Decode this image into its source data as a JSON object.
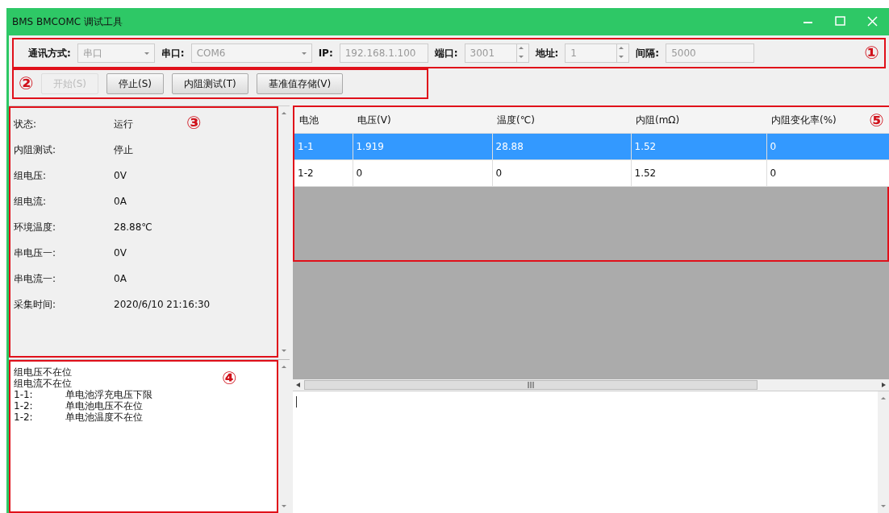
{
  "window": {
    "title": "BMS BMCOMC 调试工具"
  },
  "settings": [
    {
      "kind": "combo",
      "label": "通讯方式:",
      "value": "串口",
      "disabled": true
    },
    {
      "kind": "combo",
      "label": "串口:",
      "value": "COM6",
      "disabled": true
    },
    {
      "kind": "text",
      "label": "IP:",
      "value": "192.168.1.100",
      "disabled": true
    },
    {
      "kind": "spin",
      "label": "端口:",
      "value": "3001",
      "disabled": true
    },
    {
      "kind": "spin",
      "label": "地址:",
      "value": "1",
      "disabled": true
    },
    {
      "kind": "text",
      "label": "间隔:",
      "value": "5000",
      "disabled": true
    }
  ],
  "buttons": [
    {
      "label": "开始(S)",
      "disabled": true
    },
    {
      "label": "停止(S)",
      "disabled": false
    },
    {
      "label": "内阻测试(T)",
      "disabled": false
    },
    {
      "label": "基准值存储(V)",
      "disabled": false
    }
  ],
  "status": [
    {
      "label": "状态:",
      "value": "运行"
    },
    {
      "label": "内阻测试:",
      "value": "停止"
    },
    {
      "label": "组电压:",
      "value": "0V"
    },
    {
      "label": "组电流:",
      "value": "0A"
    },
    {
      "label": "环境温度:",
      "value": "28.88℃"
    },
    {
      "label": "串电压一:",
      "value": "0V"
    },
    {
      "label": "串电流一:",
      "value": "0A"
    },
    {
      "label": "采集时间:",
      "value": "2020/6/10 21:16:30"
    }
  ],
  "log": [
    {
      "text": "组电压不在位"
    },
    {
      "text": "组电流不在位"
    },
    {
      "prefix": "1-1:",
      "text": "单电池浮充电压下限"
    },
    {
      "prefix": "1-2:",
      "text": "单电池电压不在位"
    },
    {
      "prefix": "1-2:",
      "text": "单电池温度不在位"
    }
  ],
  "table": {
    "columns": [
      "电池",
      "电压(V)",
      "温度(℃)",
      "内阻(mΩ)",
      "内阻变化率(%)"
    ],
    "rows": [
      {
        "cells": [
          "1-1",
          "1.919",
          "28.88",
          "1.52",
          "0"
        ],
        "selected": true
      },
      {
        "cells": [
          "1-2",
          "0",
          "0",
          "1.52",
          "0"
        ],
        "selected": false
      }
    ]
  },
  "markers": [
    "①",
    "②",
    "③",
    "④",
    "⑤"
  ]
}
